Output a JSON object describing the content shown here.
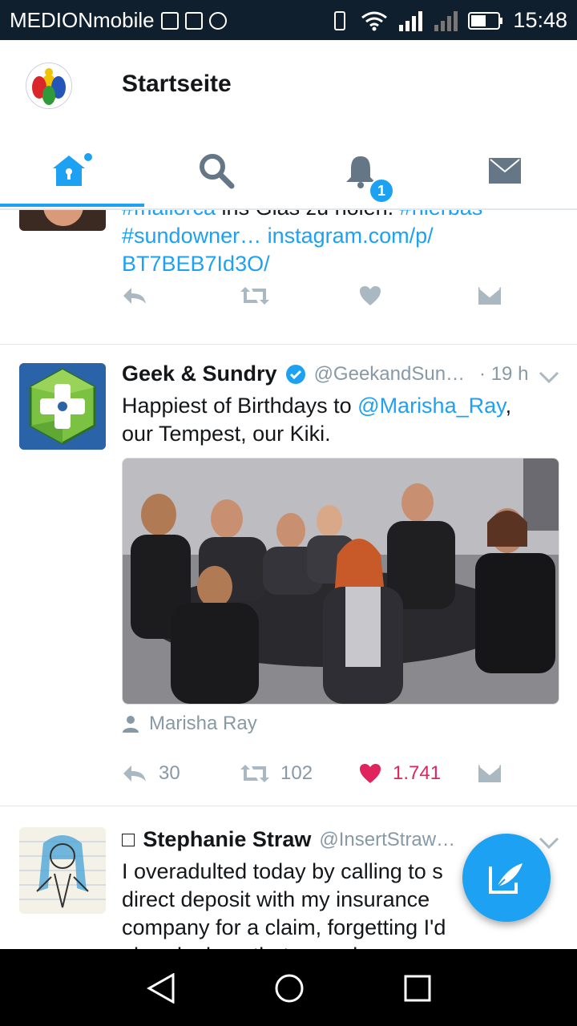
{
  "status_bar": {
    "carrier": "MEDIONmobile",
    "time": "15:48"
  },
  "header": {
    "title": "Startseite"
  },
  "tabs": [
    {
      "name": "home",
      "active": true
    },
    {
      "name": "search",
      "active": false
    },
    {
      "name": "notifications",
      "active": false,
      "badge": "1"
    },
    {
      "name": "messages",
      "active": false
    }
  ],
  "tweets": [
    {
      "id": "partial",
      "text_part1": "#mallorca",
      "text_part2": " ins Glas zu holen. ",
      "text_part3": "#hierbas",
      "text_line2": "#sundowner",
      "text_line2_rest": "… instagram.com/p/",
      "text_line3": "BT7BEB7Id3O/"
    },
    {
      "id": "geek",
      "name": "Geek & Sundry",
      "handle": "@GeekandSun…",
      "time": "· 19 h",
      "text_before": "Happiest of Birthdays to ",
      "mention": "@Marisha_Ray",
      "text_after": ",",
      "text_line2": "our Tempest, our Kiki.",
      "tagged": "Marisha Ray",
      "replies": "30",
      "retweets": "102",
      "likes": "1.741"
    },
    {
      "id": "stephanie",
      "name_prefix": "□",
      "name": "Stephanie Straw",
      "handle": "@InsertStraw…",
      "line1": "I overadulted today by calling to s",
      "line2": "direct deposit with my insurance",
      "line3": "company for a claim, forgetting I'd",
      "line4": "already done that a week ago."
    }
  ],
  "colors": {
    "accent": "#1da1f2",
    "like": "#e0245e",
    "muted": "#8899a6",
    "status_bar": "#0f1f2e"
  }
}
